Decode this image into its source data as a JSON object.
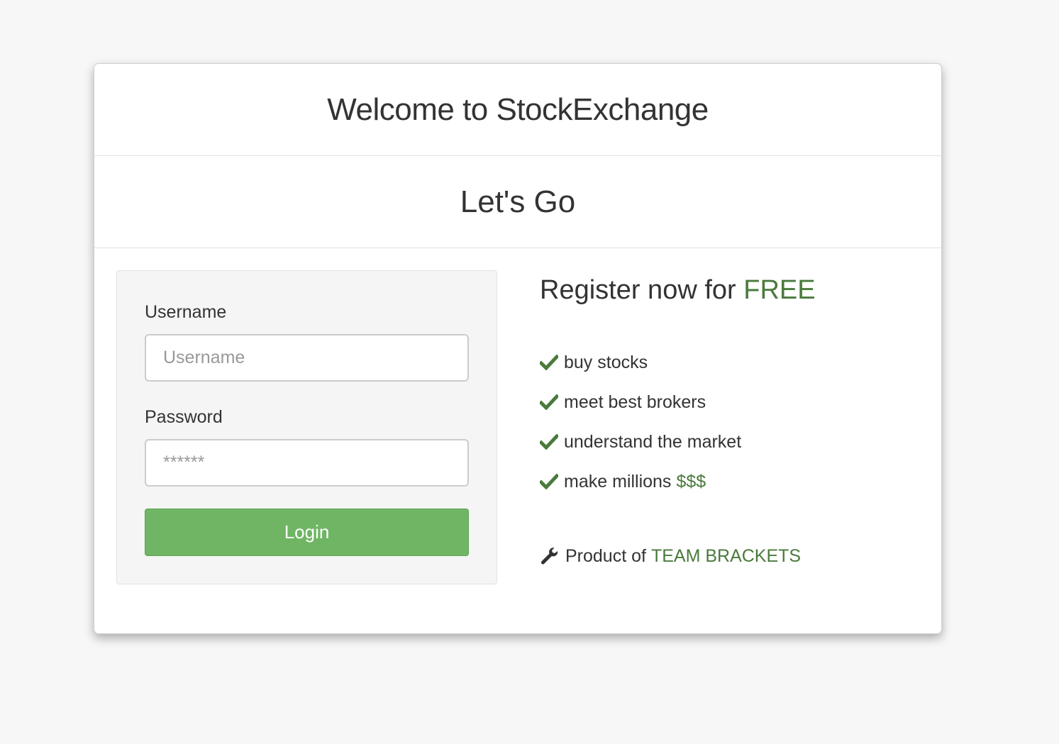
{
  "header": {
    "title": "Welcome to StockExchange"
  },
  "subheader": {
    "title": "Let's Go"
  },
  "login": {
    "username_label": "Username",
    "username_placeholder": "Username",
    "password_label": "Password",
    "password_placeholder": "******",
    "login_button": "Login"
  },
  "register": {
    "heading_prefix": "Register now for",
    "heading_highlight": "FREE",
    "features": [
      {
        "text": "buy stocks",
        "highlight": ""
      },
      {
        "text": "meet best brokers",
        "highlight": ""
      },
      {
        "text": "understand the market",
        "highlight": ""
      },
      {
        "text": "make millions",
        "highlight": "$$$"
      }
    ],
    "icon": "check-icon"
  },
  "credit": {
    "icon": "wrench-icon",
    "prefix": "Product of",
    "team": "TEAM BRACKETS"
  },
  "colors": {
    "accent_green": "#4a7a3c",
    "button_green": "#6fb564",
    "background": "#f7f7f7"
  }
}
